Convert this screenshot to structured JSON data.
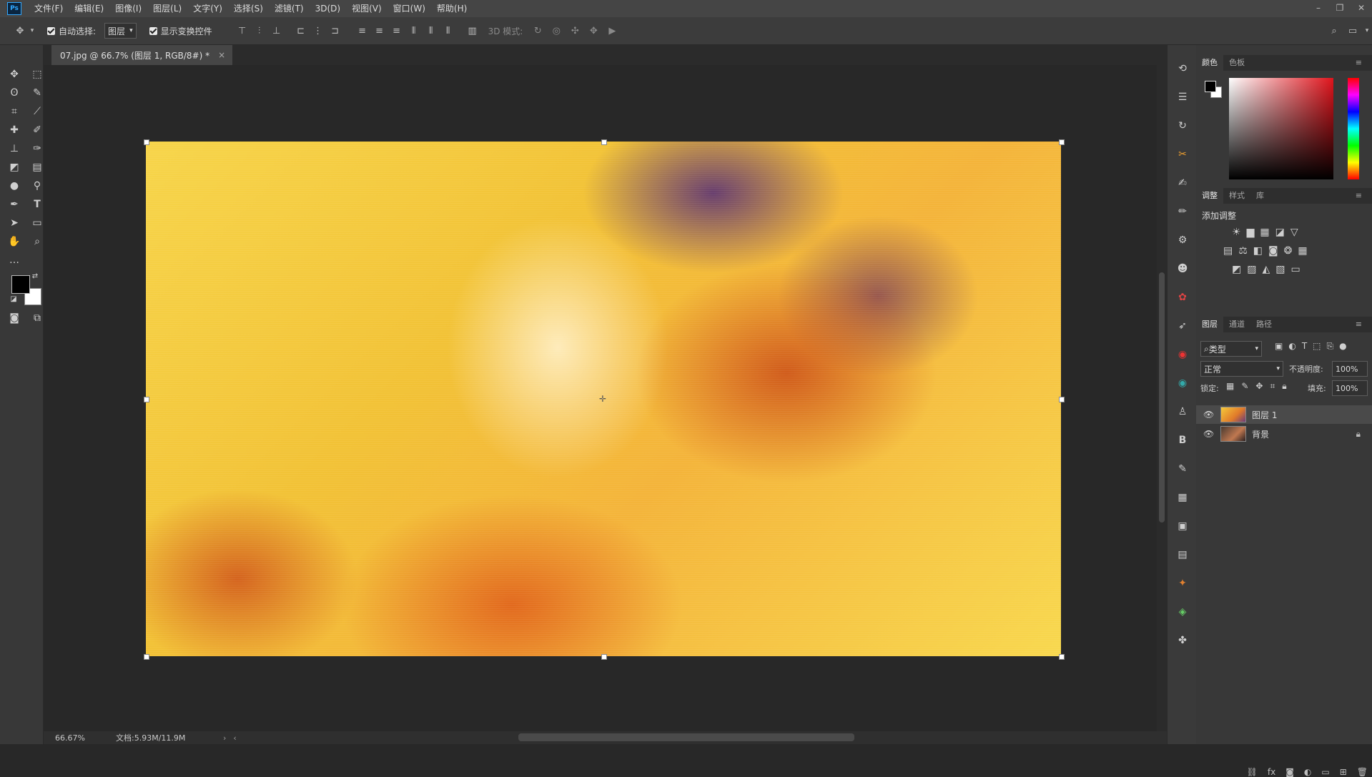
{
  "app": {
    "logo": "Ps"
  },
  "menu": [
    "文件(F)",
    "编辑(E)",
    "图像(I)",
    "图层(L)",
    "文字(Y)",
    "选择(S)",
    "滤镜(T)",
    "3D(D)",
    "视图(V)",
    "窗口(W)",
    "帮助(H)"
  ],
  "window_controls": {
    "minimize": "–",
    "restore": "❐",
    "close": "✕"
  },
  "options": {
    "auto_select_label": "自动选择:",
    "auto_select_value": "图层",
    "show_transform_label": "显示变换控件",
    "mode_3d_label": "3D 模式:"
  },
  "document": {
    "tab_title": "07.jpg @ 66.7% (图层 1, RGB/8#) *",
    "close": "×"
  },
  "status": {
    "zoom": "66.67%",
    "doc_size": "文档:5.93M/11.9M"
  },
  "color_panel": {
    "tabs": [
      "颜色",
      "色板"
    ],
    "colors": {
      "foreground": "#000000",
      "background": "#ffffff",
      "hue": "#e0141c"
    }
  },
  "adjustments_panel": {
    "tabs": [
      "调整",
      "样式",
      "库"
    ],
    "title": "添加调整"
  },
  "layers_panel": {
    "tabs": [
      "图层",
      "通道",
      "路径"
    ],
    "filter_label": "类型",
    "blend_mode": "正常",
    "opacity_label": "不透明度:",
    "opacity_value": "100%",
    "lock_label": "锁定:",
    "fill_label": "填充:",
    "fill_value": "100%",
    "layers": [
      {
        "name": "图层 1",
        "selected": true
      },
      {
        "name": "背景",
        "selected": false
      }
    ]
  }
}
